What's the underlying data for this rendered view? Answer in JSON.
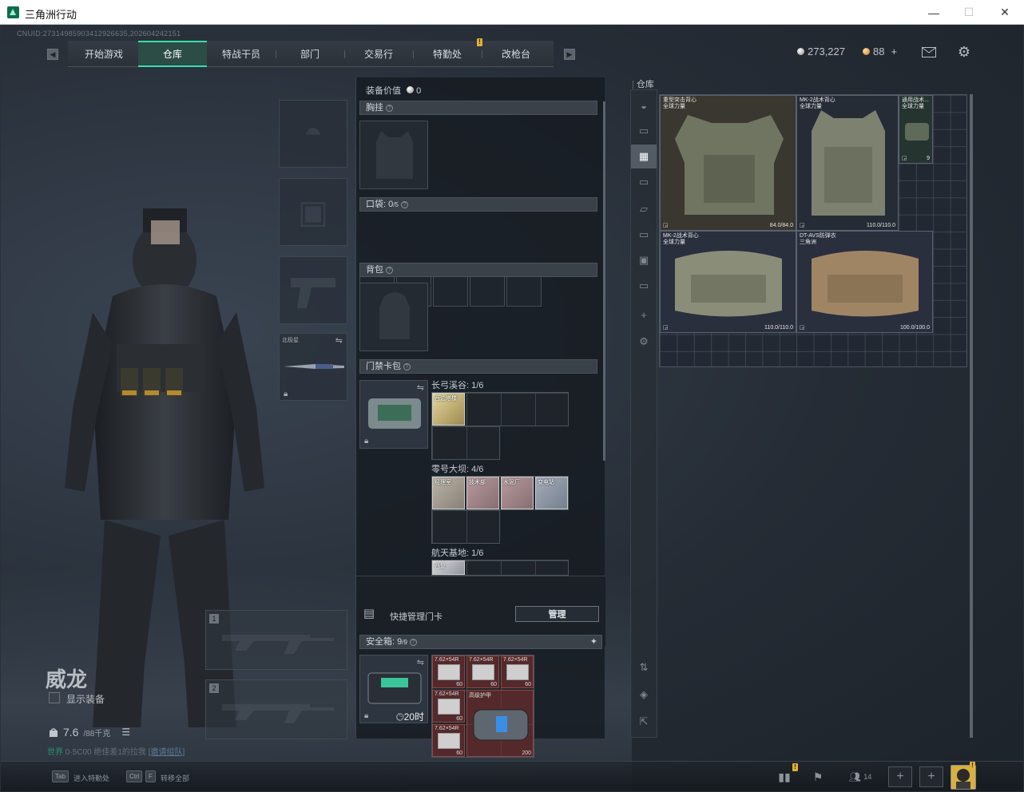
{
  "window": {
    "title": "三角洲行动",
    "minimize": "—",
    "maximize": "☐",
    "close": "✕"
  },
  "uid_line": "CNUID:27314985903412926635,202604242151",
  "nav": {
    "left_key": "◀",
    "right_key": "▶",
    "tabs": [
      "开始游戏",
      "仓库",
      "特战干员",
      "部门",
      "交易行",
      "特勤处",
      "改枪台"
    ],
    "active_tab": "仓库",
    "badge_tab": "特勤处",
    "badge": "!"
  },
  "currency": {
    "silver": "273,227",
    "gold": "88",
    "gold_plus": "+"
  },
  "icons": {
    "mail": "mail-icon",
    "settings": "gear-icon"
  },
  "character": {
    "name": "威龙",
    "show_gear_label": "显示装备",
    "weight": "7.6",
    "weight_max": "/88千克",
    "hint_prefix": "世界",
    "hint_mid": "0·5C00",
    "hint_text": "绝佳差1的拉我",
    "hint_link": "[邀请组队]"
  },
  "loadout": {
    "melee_label": "北极星",
    "weapon1_num": "1",
    "weapon2_num": "2"
  },
  "equip": {
    "value_label": "装备价值",
    "value": "0",
    "chest_rig": "胸挂",
    "pockets_label": "口袋:",
    "pockets_val": "0",
    "pockets_max": "/5",
    "backpack": "背包",
    "keycard_case": "门禁卡包",
    "maps": [
      {
        "name": "长弓溪谷:",
        "count": "1/6"
      },
      {
        "name": "零号大坝:",
        "count": "4/6"
      },
      {
        "name": "航天基地:",
        "count": "1/6"
      }
    ],
    "cards_m1": [
      "西边塔楼"
    ],
    "cards_m2": [
      "经理室",
      "技术部",
      "水泥厂",
      "变电站"
    ],
    "cards_m3": [
      "西复"
    ],
    "quick_manage": "快捷管理门卡",
    "manage_btn": "管理",
    "safe_label": "安全箱:",
    "safe_val": "9",
    "safe_max": "/9",
    "safe_timer": "20时",
    "ammo": [
      {
        "t": "7.62×54R",
        "n": "60"
      },
      {
        "t": "7.62×54R",
        "n": "60"
      },
      {
        "t": "7.62×54R",
        "n": "60"
      },
      {
        "t": "7.62×54R",
        "n": "60"
      },
      {
        "t": "7.62×54R",
        "n": "60"
      }
    ],
    "armor_plate_label": "高级护甲",
    "armor_plate_val": "200"
  },
  "warehouse": {
    "title": "仓库",
    "items": [
      {
        "name1": "重型突击背心",
        "name2": "全球力量",
        "dur": "84.0/84.0"
      },
      {
        "name1": "MK-2战术背心",
        "name2": "全球力量",
        "dur": "110.0/110.0"
      },
      {
        "name1": "通用战术...",
        "name2": "全球力量",
        "dur": "9"
      },
      {
        "name1": "MK-2战术背心",
        "name2": "全球力量",
        "dur": "110.0/110.0"
      },
      {
        "name1": "DT-AVS防弹衣",
        "name2": "三角洲",
        "dur": "100.0/100.0"
      }
    ]
  },
  "bottom": {
    "key1": "Tab",
    "label1": "进入特勤处",
    "key2a": "Ctrl",
    "key2b": "F",
    "label2": "转移全部",
    "friends": "14",
    "plus": "+"
  },
  "colors": {
    "accent": "#37e0a8",
    "badge": "#e0b033"
  }
}
